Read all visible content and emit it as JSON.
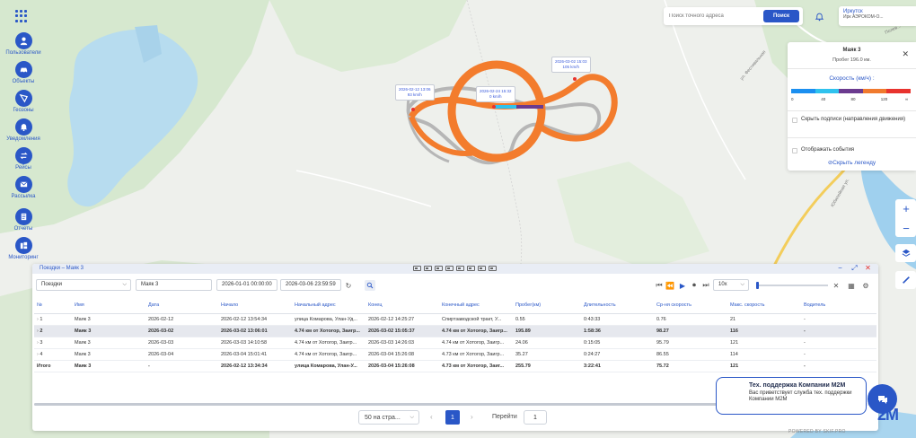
{
  "nav": [
    {
      "key": "users",
      "label": "Пользователи",
      "icon": "user-icon"
    },
    {
      "key": "objects",
      "label": "Объекты",
      "icon": "car-icon"
    },
    {
      "key": "geozones",
      "label": "Геозоны",
      "icon": "geozone-icon"
    },
    {
      "key": "notifications",
      "label": "Уведомления",
      "icon": "bell-icon"
    },
    {
      "key": "routes",
      "label": "Рейсы",
      "icon": "routes-icon"
    },
    {
      "key": "mailing",
      "label": "Рассылка",
      "icon": "mail-icon"
    },
    {
      "key": "reports",
      "label": "Отчеты",
      "icon": "report-icon"
    },
    {
      "key": "monitoring",
      "label": "Мониторинг",
      "icon": "monitoring-icon"
    }
  ],
  "search": {
    "placeholder": "Поиск точного адреса",
    "button": "Поиск"
  },
  "user": {
    "city": "Иркутск",
    "company": "Ирк АЭРОКОМ-О..."
  },
  "map": {
    "labels": {
      "street1": "ул. Фестивальная",
      "street2": "Юбилейная ул.",
      "street3": "Полев..."
    },
    "pins": [
      {
        "time": "2026-02-12 13:06",
        "speed": "93 km/h"
      },
      {
        "time": "2026-02-24 15:32",
        "speed": "0 km/h"
      },
      {
        "time": "2026-03-02 15:03",
        "speed": "105 km/h"
      }
    ]
  },
  "legend": {
    "title": "Маяк 3",
    "mileage": "Пробег 196.0 км.",
    "speed_label": "Скорость (км/ч) :",
    "colors": [
      "#1b8ff0",
      "#2fc2ee",
      "#6b3b8f",
      "#f07a2e",
      "#e8332e"
    ],
    "ticks": [
      "0",
      "40",
      "80",
      "120",
      "∞"
    ],
    "hide_labels": "Скрыть подписи (направления движения)",
    "show_events": "Отображать события",
    "hide_legend": "Скрыть легенду"
  },
  "panel": {
    "title": "Поездки – Маяк 3",
    "report_type": "Поездки",
    "object": "Маяк 3",
    "date_from": "2026-01-01 00:00:00",
    "date_to": "2026-03-06 23:59:59",
    "playback_speed": "10x"
  },
  "table": {
    "headers": [
      "№",
      "Имя",
      "Дата",
      "Начало",
      "Начальный адрес",
      "Конец",
      "Конечный адрес",
      "Пробег(км)",
      "Длительность",
      "Ср-ня скорость",
      "Макс. скорость",
      "Водитель"
    ],
    "rows": [
      {
        "n": "1",
        "name": "Маяк 3",
        "date": "2026-02-12",
        "start": "2026-02-12 13:54:34",
        "start_addr": "улица Комарова, Улан-Уд...",
        "end": "2026-02-12 14:25:27",
        "end_addr": "Спиртзаводской тракт, У...",
        "mileage": "0.55",
        "duration": "0:43:33",
        "avg": "0.76",
        "max": "21",
        "driver": "-"
      },
      {
        "n": "2",
        "name": "Маяк 3",
        "date": "2026-03-02",
        "start": "2026-03-02 13:06:01",
        "start_addr": "4.74 км от Хотогор, Заигр...",
        "end": "2026-03-02 15:05:37",
        "end_addr": "4.74 км от Хотогор, Заигр...",
        "mileage": "195.89",
        "duration": "1:58:36",
        "avg": "98.27",
        "max": "116",
        "driver": "-"
      },
      {
        "n": "3",
        "name": "Маяк 3",
        "date": "2026-03-03",
        "start": "2026-03-03 14:10:58",
        "start_addr": "4.74 км от Хотогор, Заигр...",
        "end": "2026-03-03 14:26:03",
        "end_addr": "4.74 км от Хотогор, Заигр...",
        "mileage": "24.06",
        "duration": "0:15:05",
        "avg": "95.79",
        "max": "121",
        "driver": "-"
      },
      {
        "n": "4",
        "name": "Маяк 3",
        "date": "2026-03-04",
        "start": "2026-03-04 15:01:41",
        "start_addr": "4.74 км от Хотогор, Заигр...",
        "end": "2026-03-04 15:26:08",
        "end_addr": "4.73 км от Хотогор, Заигр...",
        "mileage": "35.27",
        "duration": "0:24:27",
        "avg": "86.55",
        "max": "114",
        "driver": "-"
      }
    ],
    "total": {
      "n": "Итого",
      "name": "Маяк 3",
      "date": "-",
      "start": "2026-02-12 13:34:34",
      "start_addr": "улица Комарова, Улан-У...",
      "end": "2026-03-04 15:26:08",
      "end_addr": "4.73 км от Хотогор, Заиг...",
      "mileage": "255.79",
      "duration": "3:22:41",
      "avg": "75.72",
      "max": "121",
      "driver": "-"
    }
  },
  "pager": {
    "per_page": "50 на стра...",
    "page": "1",
    "goto_label": "Перейти",
    "goto_value": "1"
  },
  "support": {
    "title": "Тех. поддержка Компании M2M",
    "body": "Вас приветствует служба тех. поддержки Компании M2M"
  },
  "brand": {
    "logo": "2M",
    "powered": "POWERED BY SKIF.PRO"
  }
}
